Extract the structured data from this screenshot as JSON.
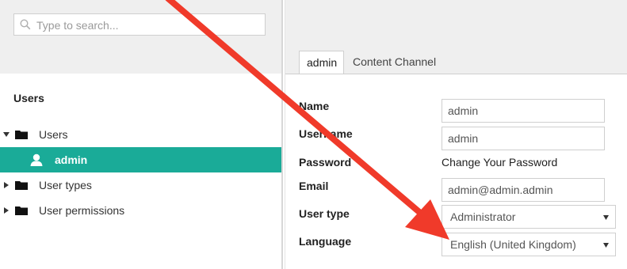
{
  "search": {
    "placeholder": "Type to search..."
  },
  "tree": {
    "title": "Users",
    "items": [
      {
        "label": "Users"
      },
      {
        "label": "admin"
      },
      {
        "label": "User types"
      },
      {
        "label": "User permissions"
      }
    ]
  },
  "tabs": [
    {
      "label": "admin"
    },
    {
      "label": "Content Channel"
    }
  ],
  "form": {
    "name_label": "Name",
    "name_value": "admin",
    "username_label": "Username",
    "username_value": "admin",
    "password_label": "Password",
    "password_link": "Change Your Password",
    "email_label": "Email",
    "email_value": "admin@admin.admin",
    "usertype_label": "User type",
    "usertype_value": "Administrator",
    "language_label": "Language",
    "language_value": "English (United Kingdom)"
  },
  "colors": {
    "accent": "#1aab98",
    "annotation_arrow": "#f03a2a"
  }
}
